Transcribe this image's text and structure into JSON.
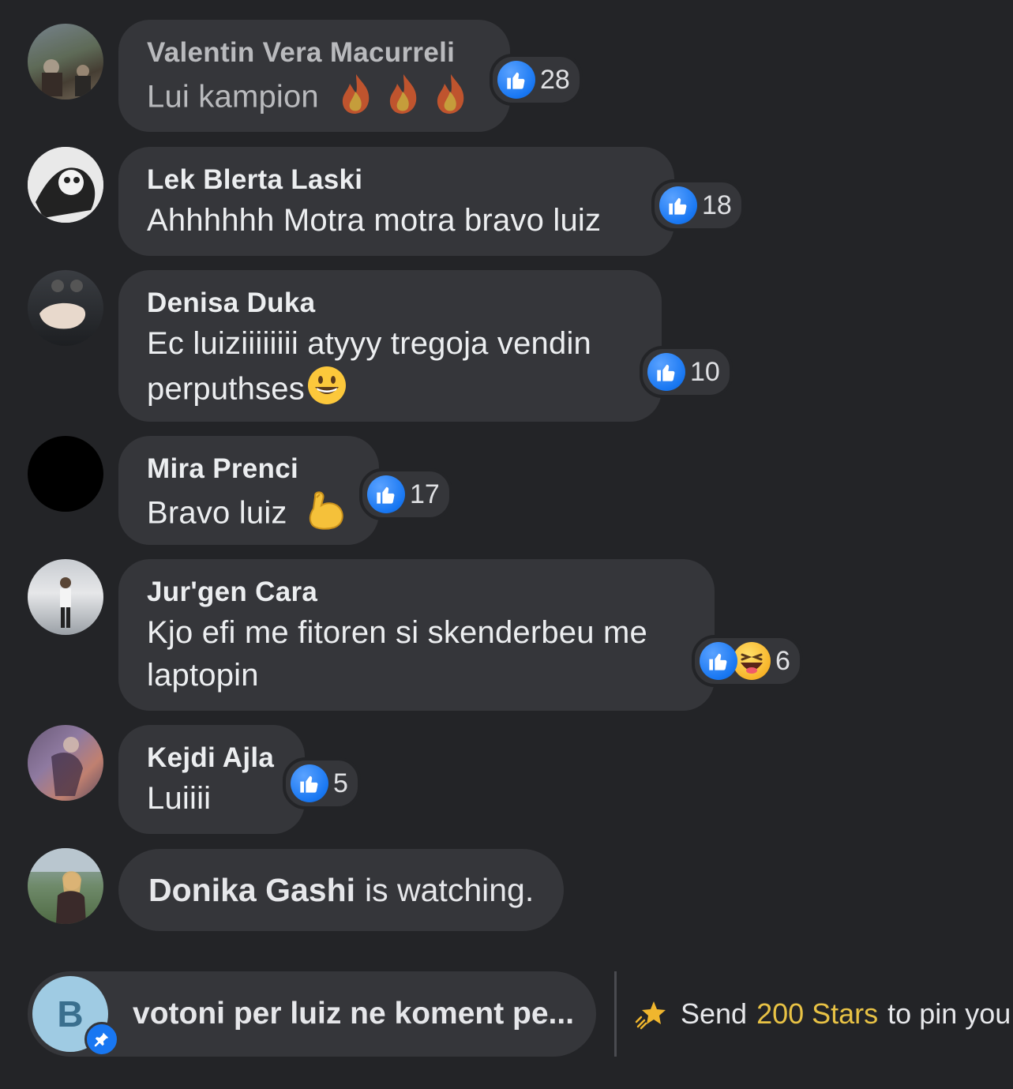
{
  "comments": [
    {
      "name": "Valentin Vera Macurreli",
      "text": "Lui kampion",
      "reactions": {
        "count": "28",
        "types": [
          "like"
        ]
      }
    },
    {
      "name": "Lek Blerta Laski",
      "text": "Ahhhhhh Motra motra  bravo luiz",
      "reactions": {
        "count": "18",
        "types": [
          "like"
        ]
      }
    },
    {
      "name": "Denisa Duka",
      "text_line1": "Ec luiziiiiiiii atyyy tregoja vendin",
      "text_line2": "perputhses",
      "reactions": {
        "count": "10",
        "types": [
          "like"
        ]
      }
    },
    {
      "name": "Mira Prenci",
      "text": "Bravo luiz",
      "reactions": {
        "count": "17",
        "types": [
          "like"
        ]
      }
    },
    {
      "name": "Jur'gen Cara",
      "text_line1": "Kjo efi me fitoren si skenderbeu me",
      "text_line2": "laptopin",
      "reactions": {
        "count": "6",
        "types": [
          "like",
          "haha"
        ]
      }
    },
    {
      "name": "Kejdi Ajla",
      "text": "Luiiii",
      "reactions": {
        "count": "5",
        "types": [
          "like"
        ]
      }
    }
  ],
  "watching": {
    "name": "Donika Gashi",
    "suffix": "is watching."
  },
  "pinned": {
    "avatar_letter": "B",
    "text": "votoni per luiz ne koment pe..."
  },
  "stars_cta": {
    "prefix": "Send",
    "amount": "200 Stars",
    "suffix": "to pin you"
  },
  "colors": {
    "background": "#232427",
    "bubble": "#35363a",
    "like_blue": "#1877f2",
    "stars_gold": "#e8c245"
  }
}
